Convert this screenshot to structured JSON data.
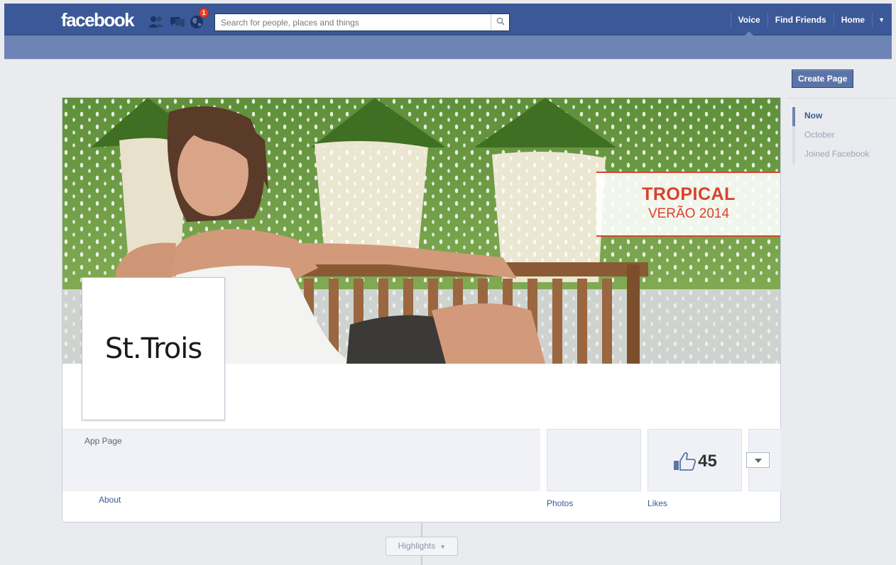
{
  "topbar": {
    "logo": "facebook",
    "notifications_count": "1",
    "search_placeholder": "Search for people, places and things",
    "nav": [
      "Voice",
      "Find Friends",
      "Home"
    ],
    "colors": {
      "bar": "#3b5998",
      "subbar": "#6d84b4"
    },
    "icons": [
      "friend-requests-icon",
      "messages-icon",
      "notifications-globe-icon",
      "search-icon",
      "account-menu-caret-icon"
    ]
  },
  "right_column": {
    "create_page": "Create Page",
    "timeline_nav": [
      {
        "label": "Now",
        "active": true
      },
      {
        "label": "October",
        "active": false
      },
      {
        "label": "Joined Facebook",
        "active": false
      }
    ]
  },
  "cover": {
    "caption_line1": "TROPICAL",
    "caption_line2": "VERÃO 2014",
    "accent_color": "#d9412b"
  },
  "profile": {
    "logo_text": "St.Trois"
  },
  "info": {
    "category": "App Page",
    "likes_count": "45",
    "tabs": {
      "about": "About",
      "photos": "Photos",
      "likes": "Likes"
    }
  },
  "highlights": {
    "label": "Highlights"
  }
}
